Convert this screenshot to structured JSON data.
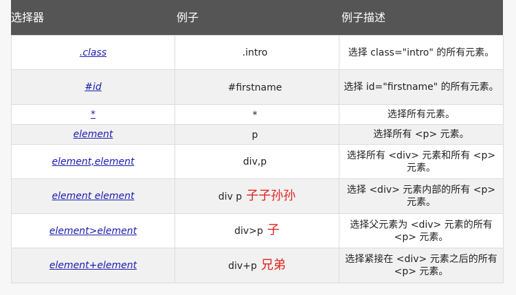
{
  "header": {
    "col1": "选择器",
    "col2": "例子",
    "col3": "例子描述"
  },
  "rows": [
    {
      "selector": ".class",
      "example": ".intro",
      "note": "",
      "description": "选择 class=\"intro\" 的所有元素。"
    },
    {
      "selector": "#id",
      "example": "#firstname",
      "note": "",
      "description": "选择 id=\"firstname\" 的所有元素。"
    },
    {
      "selector": "*",
      "example": "*",
      "note": "",
      "description": "选择所有元素。"
    },
    {
      "selector": "element",
      "example": "p",
      "note": "",
      "description": "选择所有 <p> 元素。"
    },
    {
      "selector": "element,element",
      "example": "div,p",
      "note": "",
      "description": "选择所有 <div> 元素和所有 <p> 元素。"
    },
    {
      "selector": "element element",
      "example": "div p",
      "note": "子子孙孙",
      "description": "选择 <div> 元素内部的所有 <p> 元素。"
    },
    {
      "selector": "element>element",
      "example": "div>p",
      "note": "子",
      "description": "选择父元素为 <div> 元素的所有 <p> 元素。"
    },
    {
      "selector": "element+element",
      "example": "div+p",
      "note": "兄弟",
      "description": "选择紧接在 <div> 元素之后的所有 <p> 元素。"
    }
  ]
}
